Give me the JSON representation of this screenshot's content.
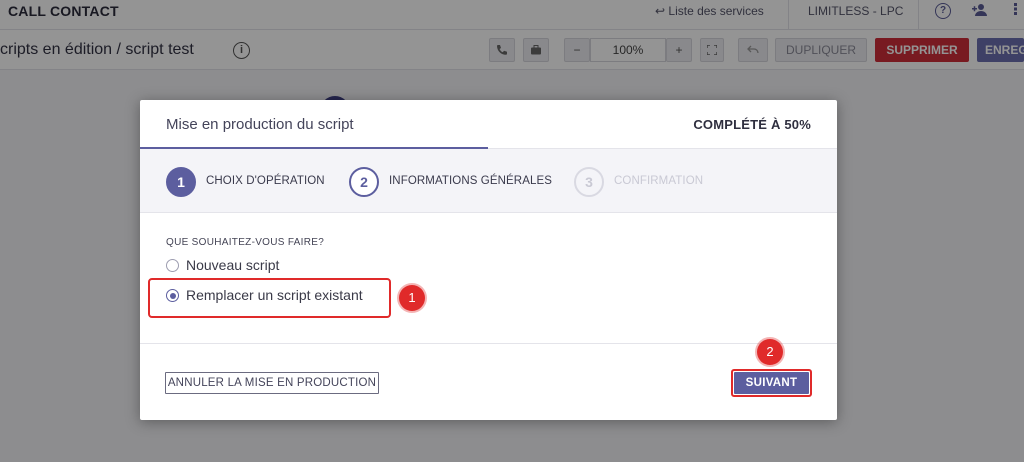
{
  "app": {
    "brand": "CALL CONTACT",
    "services_link": "↩ Liste des services",
    "account": "LIMITLESS - LPC",
    "help_icon": "help-circle-icon",
    "add_user_icon": "add-user-icon",
    "grid_icon": "grid-icon"
  },
  "toolbar": {
    "breadcrumb": "cripts en édition / script test",
    "zoom": "100%",
    "zoom_out": "−",
    "zoom_in": "+",
    "duplicate": "DUPLIQUER",
    "delete": "SUPPRIMER",
    "save": "ENREG"
  },
  "modal": {
    "title": "Mise en production du script",
    "progress": "COMPLÉTÉ À 50%",
    "progress_fraction": 0.5,
    "steps": [
      {
        "num": "1",
        "label": "CHOIX D'OPÉRATION"
      },
      {
        "num": "2",
        "label": "INFORMATIONS GÉNÉRALES"
      },
      {
        "num": "3",
        "label": "CONFIRMATION"
      }
    ],
    "question": "QUE SOUHAITEZ-VOUS FAIRE?",
    "options": [
      {
        "label": "Nouveau script",
        "checked": false
      },
      {
        "label": "Remplacer un script existant",
        "checked": true
      }
    ],
    "cancel": "ANNULER LA MISE EN PRODUCTION",
    "next": "SUIVANT"
  },
  "annotations": {
    "badge_1": "1",
    "badge_2": "2",
    "color": "#e02a2a"
  },
  "colors": {
    "primary": "#5c5e9f",
    "danger": "#cf2e3a"
  }
}
